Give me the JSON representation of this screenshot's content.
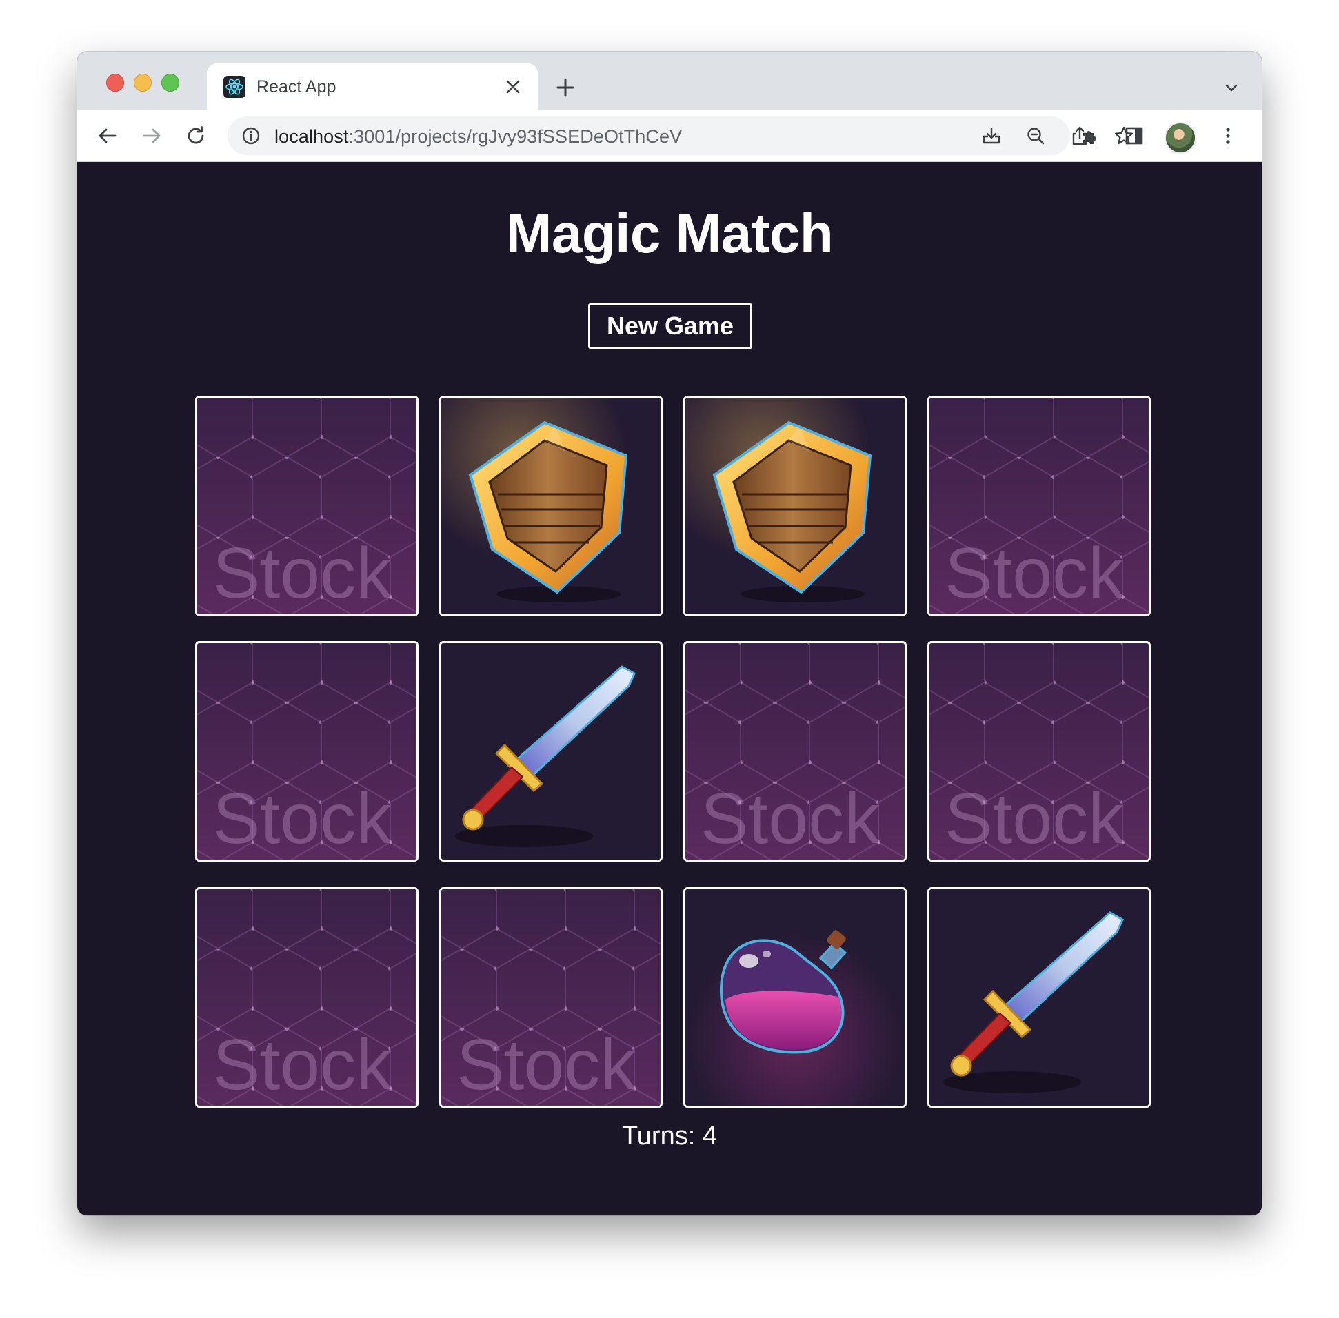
{
  "browser": {
    "tab_title": "React App",
    "url_host": "localhost",
    "url_rest": ":3001/projects/rgJvy93fSSEDeOtThCeV",
    "icons": [
      "react-favicon",
      "close-icon",
      "plus-icon",
      "chevron-down-icon",
      "back-arrow-icon",
      "forward-arrow-icon",
      "reload-icon",
      "info-icon",
      "install-icon",
      "zoom-icon",
      "share-icon",
      "star-icon",
      "puzzle-icon",
      "side-panel-icon",
      "avatar",
      "kebab-menu-icon"
    ]
  },
  "game": {
    "title": "Magic Match",
    "new_game_label": "New Game",
    "turns_label": "Turns: 4",
    "card_back_watermark": "Stock",
    "cards": [
      {
        "face": "back"
      },
      {
        "face": "shield"
      },
      {
        "face": "shield"
      },
      {
        "face": "back"
      },
      {
        "face": "back"
      },
      {
        "face": "sword"
      },
      {
        "face": "back"
      },
      {
        "face": "back"
      },
      {
        "face": "back"
      },
      {
        "face": "back"
      },
      {
        "face": "potion"
      },
      {
        "face": "sword"
      }
    ]
  },
  "colors": {
    "page_background": "#1b1627",
    "card_back": "#4a2653",
    "card_front": "#231a33",
    "text": "#ffffff"
  }
}
